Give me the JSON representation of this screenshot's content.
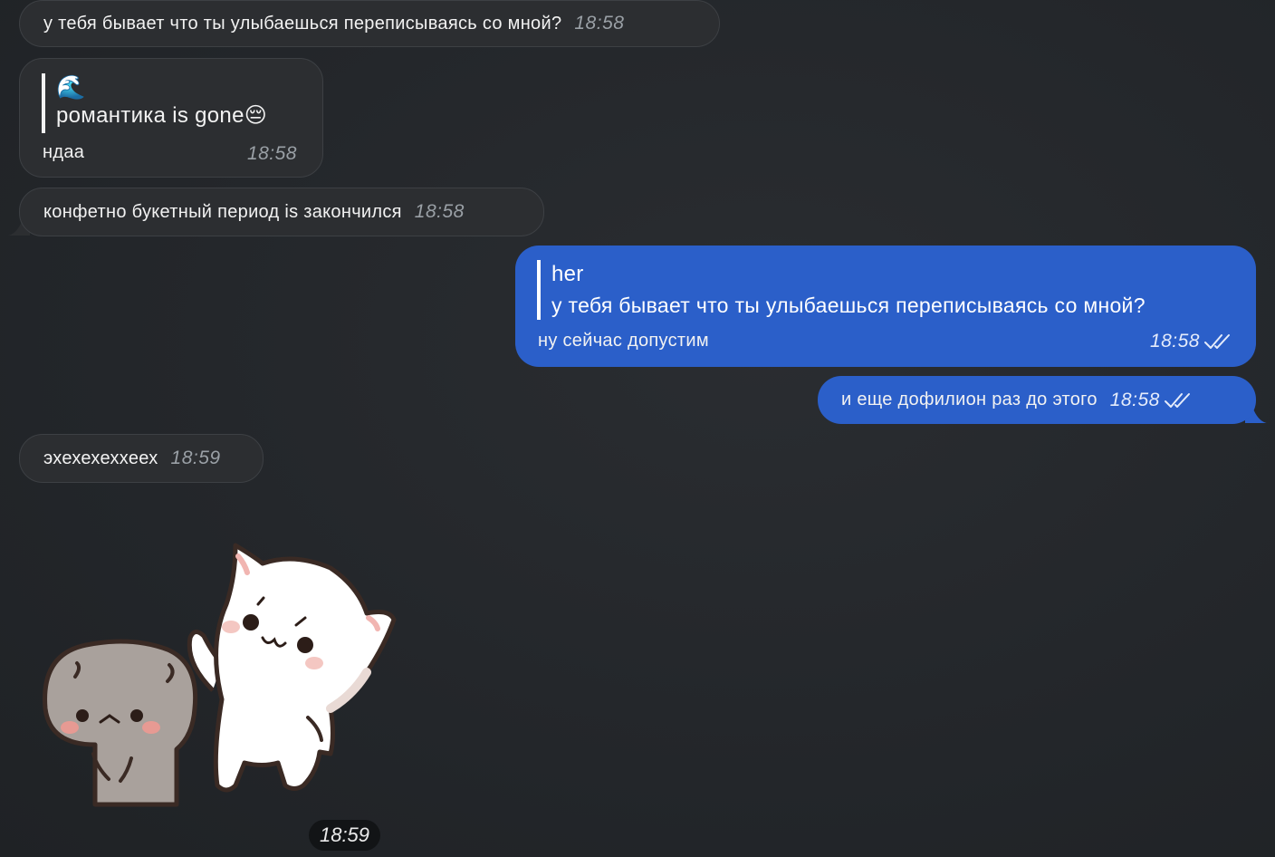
{
  "messages": {
    "m1": {
      "text": "у тебя бывает что ты улыбаешься переписываясь со мной?",
      "time": "18:58"
    },
    "m2": {
      "quote_emoji": "🌊",
      "quote_text": "романтика is gone😔",
      "text": "ндаа",
      "time": "18:58"
    },
    "m3": {
      "text": "конфетно букетный период is закончился",
      "time": "18:58"
    },
    "m4": {
      "quote_author": "her",
      "quote_text": "у тебя бывает что ты улыбаешься переписываясь со мной?",
      "text": "ну сейчас допустим",
      "time": "18:58"
    },
    "m5": {
      "text": "и еще дофилион раз до этого",
      "time": "18:58"
    },
    "m6": {
      "text": "эхехехеххеех",
      "time": "18:59"
    },
    "sticker": {
      "time": "18:59"
    }
  },
  "colors": {
    "background": "#23262a",
    "incoming_bubble": "#2c2e31",
    "outgoing_bubble": "#2b5fc9"
  }
}
